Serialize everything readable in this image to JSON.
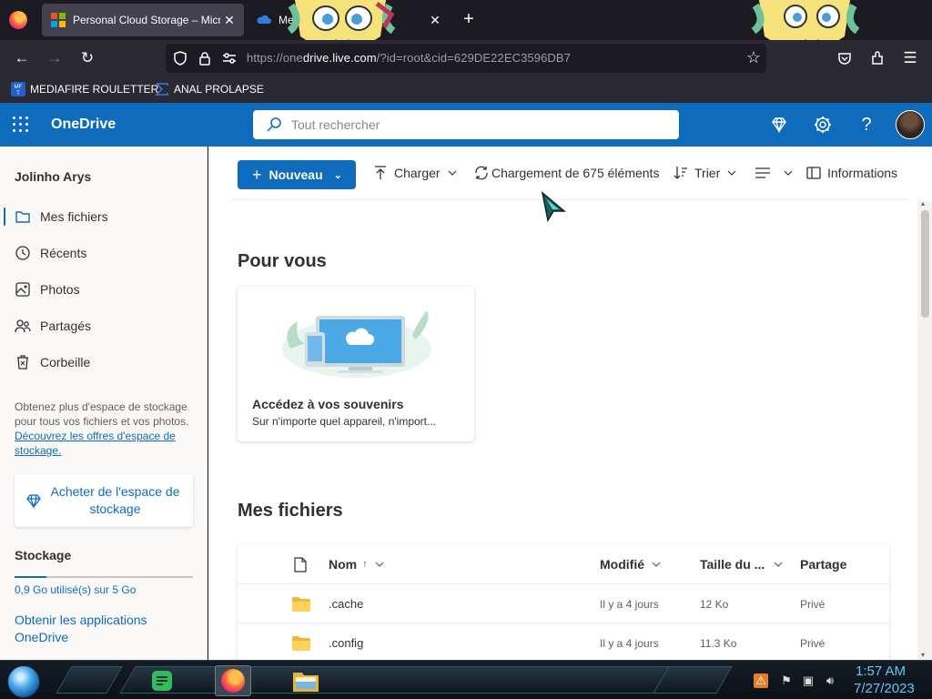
{
  "browser": {
    "tabs": [
      {
        "title": "Personal Cloud Storage – Microsoft OneDrive",
        "active": true
      },
      {
        "title": "Me",
        "active": false
      }
    ],
    "url_prefix": "https://one",
    "url_domain": "drive.live.com",
    "url_path": "/?id=root&cid=629DE22EC3596DB7",
    "bookmarks": [
      "MEDIAFIRE ROULETTER",
      "ANAL PROLAPSE"
    ]
  },
  "header": {
    "brand": "OneDrive",
    "search_placeholder": "Tout rechercher"
  },
  "sidebar": {
    "user_name": "Jolinho Arys",
    "items": [
      {
        "label": "Mes fichiers",
        "icon": "folder-icon",
        "selected": true
      },
      {
        "label": "Récents",
        "icon": "clock-icon",
        "selected": false
      },
      {
        "label": "Photos",
        "icon": "photo-icon",
        "selected": false
      },
      {
        "label": "Partagés",
        "icon": "people-icon",
        "selected": false
      },
      {
        "label": "Corbeille",
        "icon": "trash-icon",
        "selected": false
      }
    ],
    "promo_text": "Obtenez plus d'espace de stockage pour tous vos fichiers et vos photos.",
    "promo_link": "Découvrez les offres d'espace de stockage.",
    "buy_button": "Acheter de l'espace de stockage",
    "storage_title": "Stockage",
    "storage_usage": "0,9 Go utilisé(s) sur 5 Go",
    "storage_fraction": 0.18,
    "get_apps": "Obtenir les applications OneDrive"
  },
  "commandbar": {
    "new": "Nouveau",
    "upload": "Charger",
    "sync": "Chargement de 675 éléments",
    "sort": "Trier",
    "info": "Informations"
  },
  "for_you": {
    "title": "Pour vous",
    "card_title": "Accédez à vos souvenirs",
    "card_subtitle": "Sur n'importe quel appareil, n'import..."
  },
  "my_files": {
    "title": "Mes fichiers",
    "columns": {
      "name": "Nom",
      "sort_indicator": "↑",
      "modified": "Modifié",
      "size": "Taille du ...",
      "sharing": "Partage"
    },
    "rows": [
      {
        "name": ".cache",
        "modified": "Il y a 4 jours",
        "size": "12 Ko",
        "sharing": "Privé"
      },
      {
        "name": ".config",
        "modified": "Il y a 4 jours",
        "size": "11.3 Ko",
        "sharing": "Privé"
      }
    ]
  },
  "taskbar": {
    "time": "1:57 AM",
    "date": "7/27/2023"
  },
  "colors": {
    "accent": "#0f6cbd",
    "clock": "#64c6f5"
  }
}
